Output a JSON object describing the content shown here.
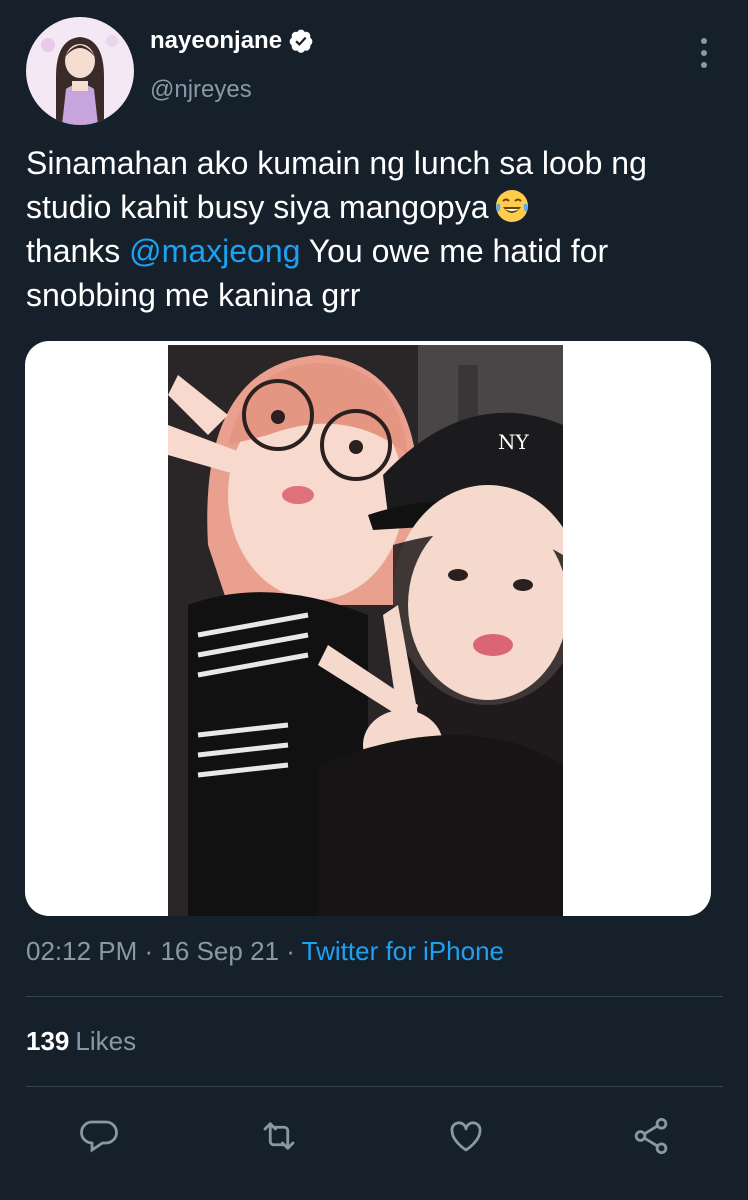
{
  "tweet": {
    "display_name": "nayeonjane",
    "handle": "@njreyes",
    "text_before": "Sinamahan ako kumain ng lunch sa loob ng studio kahit busy siya mangopya",
    "emoji": "face-with-tears-of-joy",
    "text_thanks": "thanks",
    "mention": "@maxjeong",
    "text_after": "You owe me hatid for snobbing me kanina grr",
    "time": "02:12 PM",
    "date": "16 Sep 21",
    "source": "Twitter for iPhone",
    "likes_count": "139",
    "likes_label": "Likes"
  },
  "colors": {
    "background": "#15202b",
    "accent": "#1da1f2",
    "muted": "#8899a6",
    "divider": "#38444d"
  },
  "icons": {
    "verified": "verified-badge-icon",
    "more": "vertical-ellipsis-icon",
    "reply": "reply-icon",
    "retweet": "retweet-icon",
    "like": "heart-icon",
    "share": "share-icon"
  }
}
